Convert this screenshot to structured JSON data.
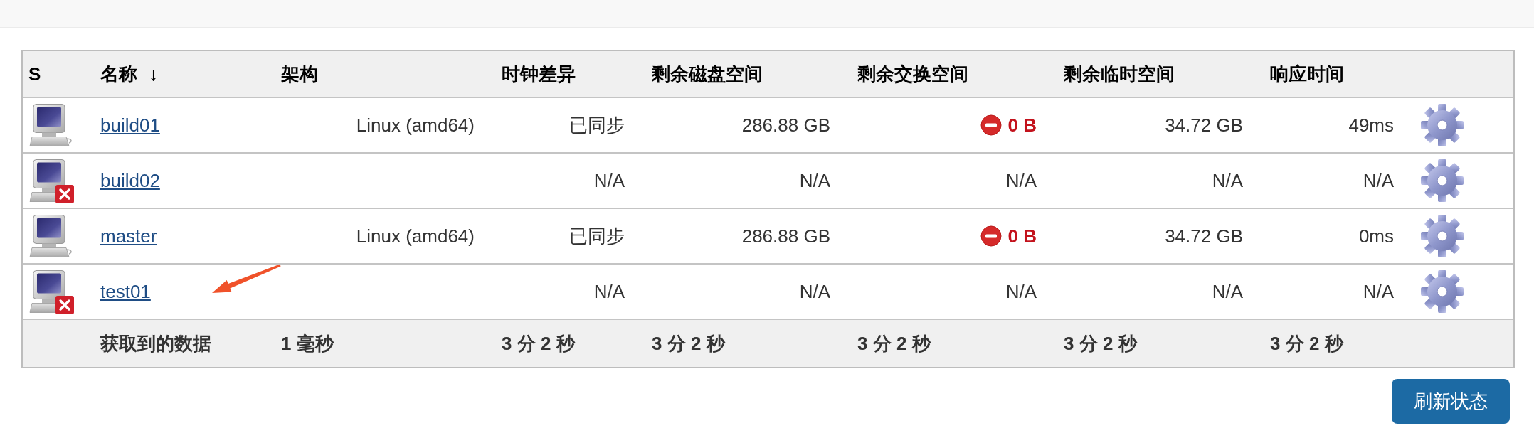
{
  "table": {
    "columns": [
      {
        "label": "S"
      },
      {
        "label": "名称",
        "sort_arrow": "↓"
      },
      {
        "label": "架构"
      },
      {
        "label": "时钟差异"
      },
      {
        "label": "剩余磁盘空间"
      },
      {
        "label": "剩余交换空间"
      },
      {
        "label": "剩余临时空间"
      },
      {
        "label": "响应时间"
      }
    ],
    "rows": [
      {
        "offline": false,
        "name": "build01",
        "architecture": "Linux (amd64)",
        "clock": "已同步",
        "disk": "286.88 GB",
        "swap": "0 B",
        "swap_warning": true,
        "temp": "34.72 GB",
        "response": "49ms"
      },
      {
        "offline": true,
        "name": "build02",
        "clock": "N/A",
        "disk": "N/A",
        "swap": "N/A",
        "swap_warning": false,
        "temp": "N/A",
        "response": "N/A"
      },
      {
        "offline": false,
        "name": "master",
        "architecture": "Linux (amd64)",
        "clock": "已同步",
        "disk": "286.88 GB",
        "swap": "0 B",
        "swap_warning": true,
        "temp": "34.72 GB",
        "response": "0ms"
      },
      {
        "offline": true,
        "name": "test01",
        "clock": "N/A",
        "disk": "N/A",
        "swap": "N/A",
        "swap_warning": false,
        "temp": "N/A",
        "response": "N/A"
      }
    ],
    "footer": {
      "label": "获取到的数据",
      "values": [
        "1 毫秒",
        "3 分 2 秒",
        "3 分 2 秒",
        "3 分 2 秒",
        "3 分 2 秒",
        "3 分 2 秒"
      ]
    }
  },
  "refresh_button": {
    "label": "刷新状态"
  }
}
